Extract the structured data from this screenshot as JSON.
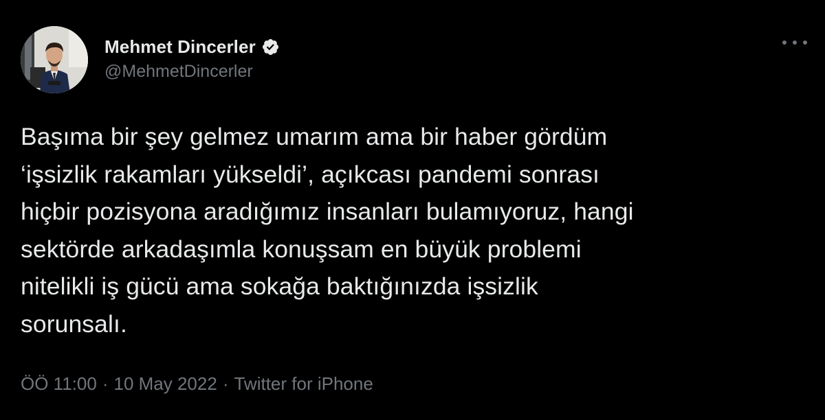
{
  "author": {
    "display_name": "Mehmet Dincerler",
    "handle": "@MehmetDincerler",
    "verified": true,
    "avatar_icon": "profile-photo"
  },
  "more_menu_icon": "ellipsis-icon",
  "tweet": {
    "lines": [
      "Başıma bir şey gelmez umarım ama bir haber gördüm",
      "‘işsizlik rakamları yükseldi’, açıkcası pandemi sonrası",
      "hiçbir pozisyona aradığımız insanları bulamıyoruz, hangi",
      "sektörde arkadaşımla konuşsam en büyük problemi",
      "nitelikli iş gücü ama sokağa baktığınızda işsizlik",
      "sorunsalı."
    ]
  },
  "meta": {
    "time": "ÖÖ 11:00",
    "separator": "·",
    "date": "10 May 2022",
    "source": "Twitter for iPhone"
  },
  "colors": {
    "background": "#000000",
    "text_primary": "#e7e9ea",
    "text_secondary": "#71767b",
    "verified": "#e7e9ea"
  }
}
